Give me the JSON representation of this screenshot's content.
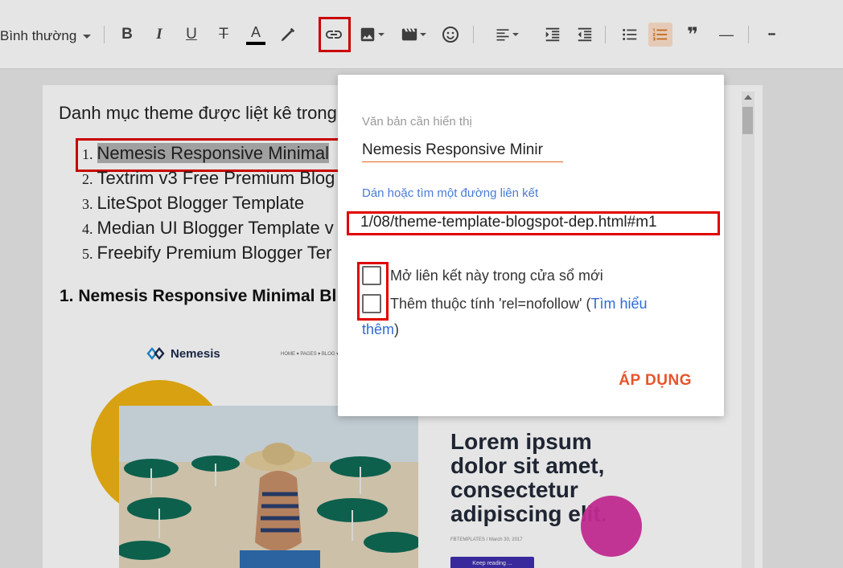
{
  "toolbar": {
    "style_select": "Bình thường",
    "icons": [
      "bold-icon",
      "italic-icon",
      "underline-icon",
      "strikethrough-icon",
      "font-color-icon",
      "highlight-icon",
      "link-icon",
      "image-icon",
      "video-icon",
      "emoji-icon",
      "align-icon",
      "indent-icon",
      "outdent-icon",
      "bullet-list-icon",
      "numbered-list-icon",
      "quote-icon",
      "horizontal-rule-icon",
      "more-icon"
    ],
    "bold": "B",
    "italic": "I",
    "underline": "U",
    "strike": "T",
    "fontcolor": "A",
    "quote": "❞",
    "hr": "—",
    "more": "•••"
  },
  "editor": {
    "intro": "Danh mục theme được liệt kê trong",
    "list": [
      {
        "num": "1.",
        "text": "Nemesis Responsive Minimal"
      },
      {
        "num": "2.",
        "text": "Textrim v3 Free Premium Blog"
      },
      {
        "num": "3.",
        "text": "LiteSpot Blogger Template"
      },
      {
        "num": "4.",
        "text": "Median UI Blogger Template v"
      },
      {
        "num": "5.",
        "text": "Freebify Premium Blogger Ter"
      }
    ],
    "heading": "1. Nemesis Responsive Minimal Bl",
    "preview": {
      "logo": "Nemesis",
      "nav": "HOME ▾   PAGES ▾   BLOG ▾",
      "hero_lines": [
        "Lorem ipsum",
        "dolor sit amet,",
        "consectetur",
        "adipiscing elit."
      ],
      "meta": "FBTEMPLATES  /  March 30, 2017",
      "button": "Keep reading ..."
    }
  },
  "dialog": {
    "text_label": "Văn bản cần hiển thị",
    "text_value": "Nemesis Responsive Minir",
    "url_label": "Dán hoặc tìm một đường liên kết",
    "url_value": "1/08/theme-template-blogspot-dep.html#m1",
    "new_window_label": "Mở liên kết này trong cửa sổ mới",
    "nofollow_prefix": "Thêm thuộc tính 'rel=nofollow' (",
    "nofollow_link": "Tìm hiểu",
    "nofollow_link2": "thêm",
    "nofollow_suffix": ")",
    "apply": "ÁP DỤNG"
  },
  "colors": {
    "accent": "#e8542a",
    "link": "#4a7bd6",
    "annotation": "#e00000"
  }
}
